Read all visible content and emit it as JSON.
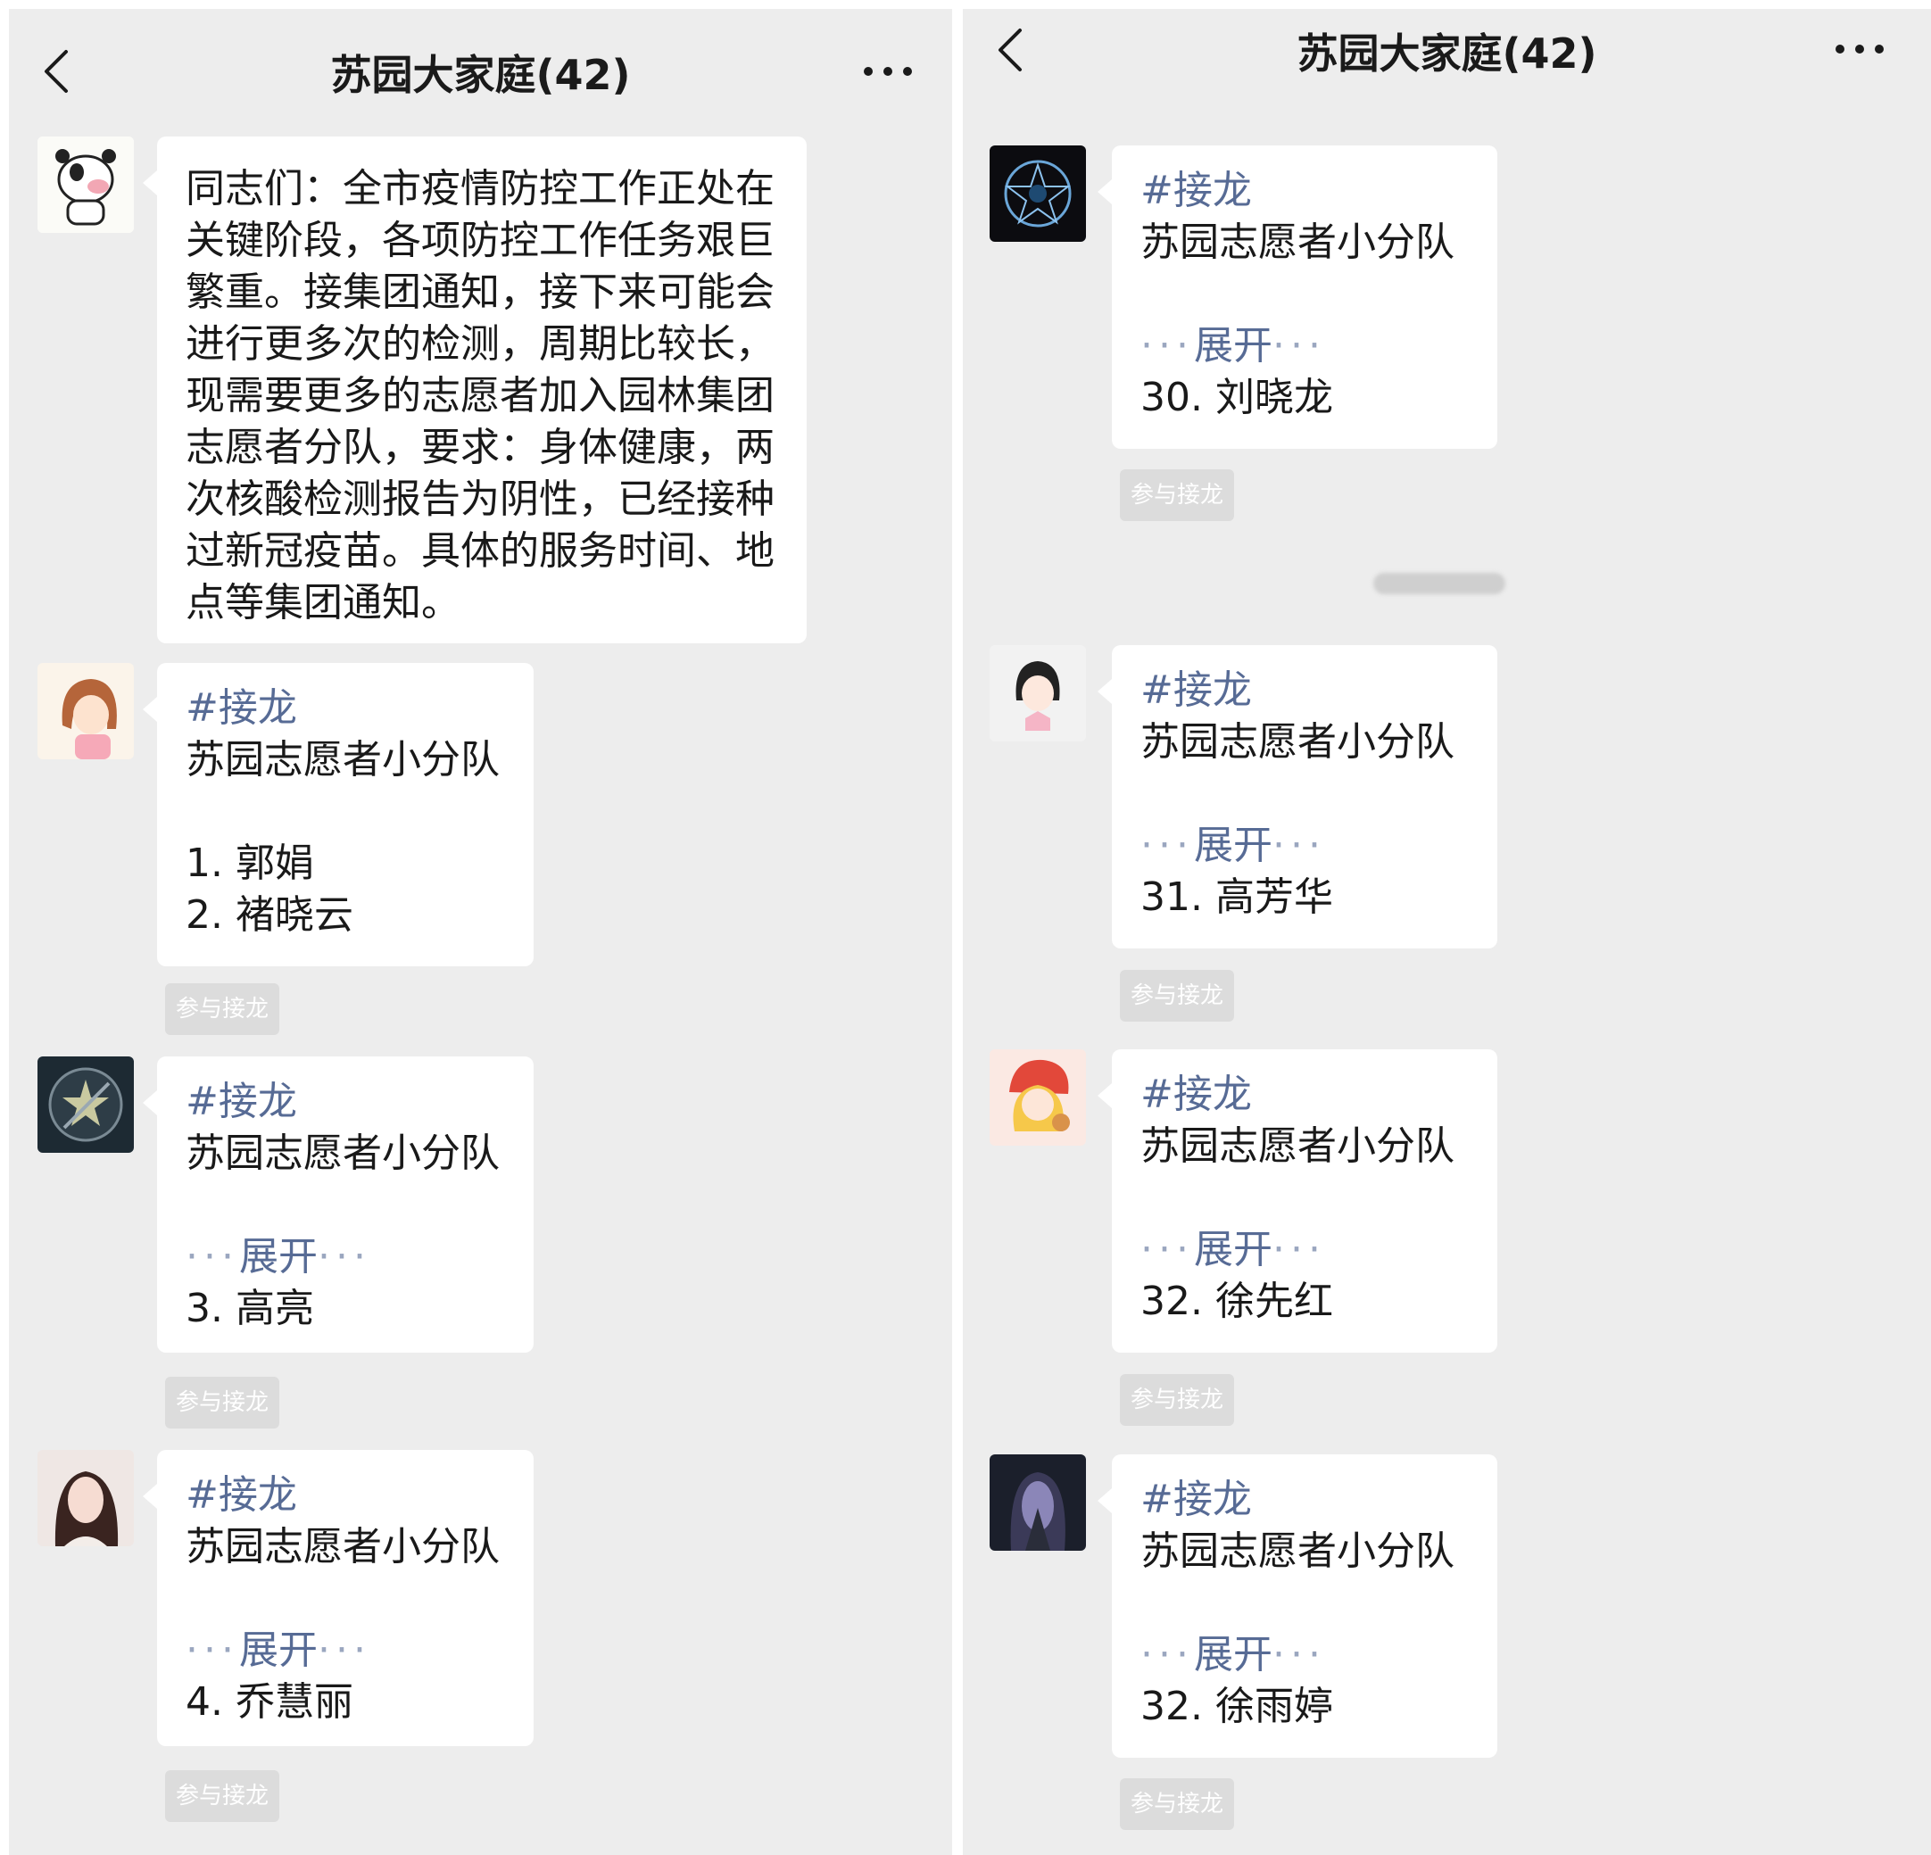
{
  "title": "苏园大家庭(42)",
  "colors": {
    "link": "#576b95",
    "bg": "#ededed",
    "bubble": "#ffffff",
    "join_button": "#dcdcdc"
  },
  "icons": {
    "back": "back-chevron-icon",
    "more": "more-dots-icon"
  },
  "join_label": "参与接龙",
  "expand_label": "展开",
  "tag": "#接龙",
  "subtitle": "苏园志愿者小分队",
  "left": {
    "announcement": "同志们：全市疫情防控工作正处在\n关键阶段，各项防控工作任务艰巨\n繁重。接集团通知，接下来可能会\n进行更多次的检测，周期比较长，\n现需要更多的志愿者加入园林集团\n志愿者分队，要求：身体健康，两\n次核酸检测报告为阴性，已经接种\n过新冠疫苗。具体的服务时间、地\n点等集团通知。",
    "messages": [
      {
        "lines": [
          "1. 郭娟",
          "2. 褚晓云"
        ]
      },
      {
        "entry": "3. 高亮"
      },
      {
        "entry": "4. 乔慧丽"
      }
    ]
  },
  "right": {
    "messages": [
      {
        "entry": "30. 刘晓龙"
      },
      {
        "entry": "31. 高芳华"
      },
      {
        "entry": "32. 徐先红"
      },
      {
        "entry": "32. 徐雨婷"
      }
    ]
  }
}
